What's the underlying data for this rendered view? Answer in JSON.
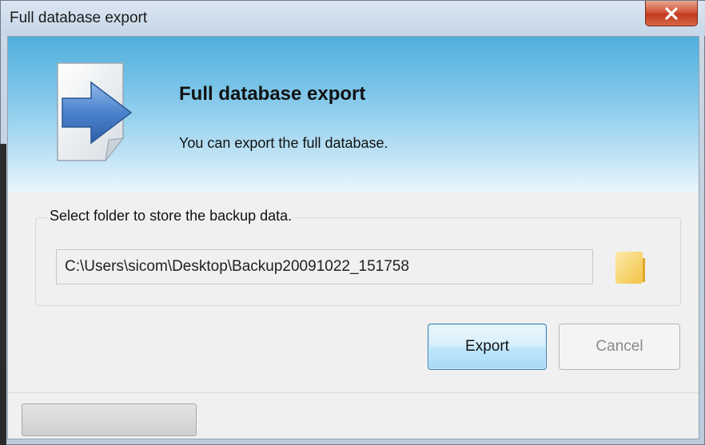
{
  "window": {
    "title": "Full database export",
    "close_symbol": "close-icon"
  },
  "header": {
    "title": "Full database export",
    "subtitle": "You can export the full database.",
    "icon": "export-document-icon"
  },
  "folder_group": {
    "label": "Select folder to store the backup data.",
    "path_value": "C:\\Users\\sicom\\Desktop\\Backup20091022_151758",
    "browse_icon": "folder-icon"
  },
  "buttons": {
    "export_label": "Export",
    "cancel_label": "Cancel"
  },
  "status": {
    "progress_fraction": 0
  },
  "colors": {
    "header_accent": "#52b0dd",
    "close_red": "#c23a1e",
    "export_border": "#3c7fb1",
    "disabled_text": "#8a8a8a"
  }
}
